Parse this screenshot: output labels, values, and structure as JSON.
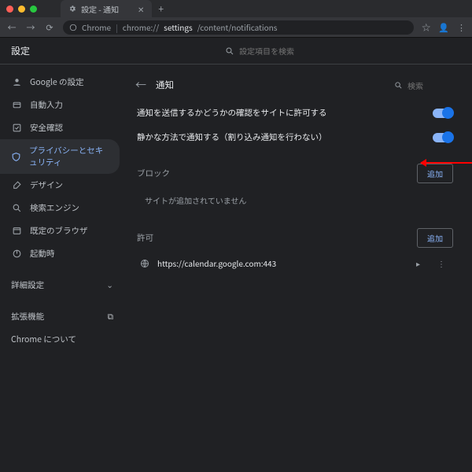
{
  "window": {
    "tab_title": "設定 - 通知",
    "url_prefix": "Chrome",
    "url_host": "chrome://",
    "url_path_strong": "settings",
    "url_path_tail": "/content/notifications"
  },
  "header": {
    "title": "設定",
    "search_placeholder": "設定項目を検索"
  },
  "sidebar": {
    "items": [
      {
        "icon": "person",
        "label": "Google の設定"
      },
      {
        "icon": "autofill",
        "label": "自動入力"
      },
      {
        "icon": "check",
        "label": "安全確認"
      },
      {
        "icon": "shield",
        "label": "プライバシーとセキュリティ",
        "active": true
      },
      {
        "icon": "brush",
        "label": "デザイン"
      },
      {
        "icon": "search",
        "label": "検索エンジン"
      },
      {
        "icon": "browser",
        "label": "既定のブラウザ"
      },
      {
        "icon": "power",
        "label": "起動時"
      }
    ],
    "advanced": "詳細設定",
    "extensions": "拡張機能",
    "about": "Chrome について"
  },
  "page": {
    "back_icon": "←",
    "title": "通知",
    "search_placeholder": "検索",
    "toggles": [
      {
        "label": "通知を送信するかどうかの確認をサイトに許可する",
        "on": true
      },
      {
        "label": "静かな方法で通知する（割り込み通知を行わない）",
        "on": true,
        "highlighted": true
      }
    ],
    "block": {
      "heading": "ブロック",
      "add": "追加",
      "empty": "サイトが追加されていません"
    },
    "allow": {
      "heading": "許可",
      "add": "追加",
      "sites": [
        {
          "url": "https://calendar.google.com:443"
        }
      ]
    }
  }
}
